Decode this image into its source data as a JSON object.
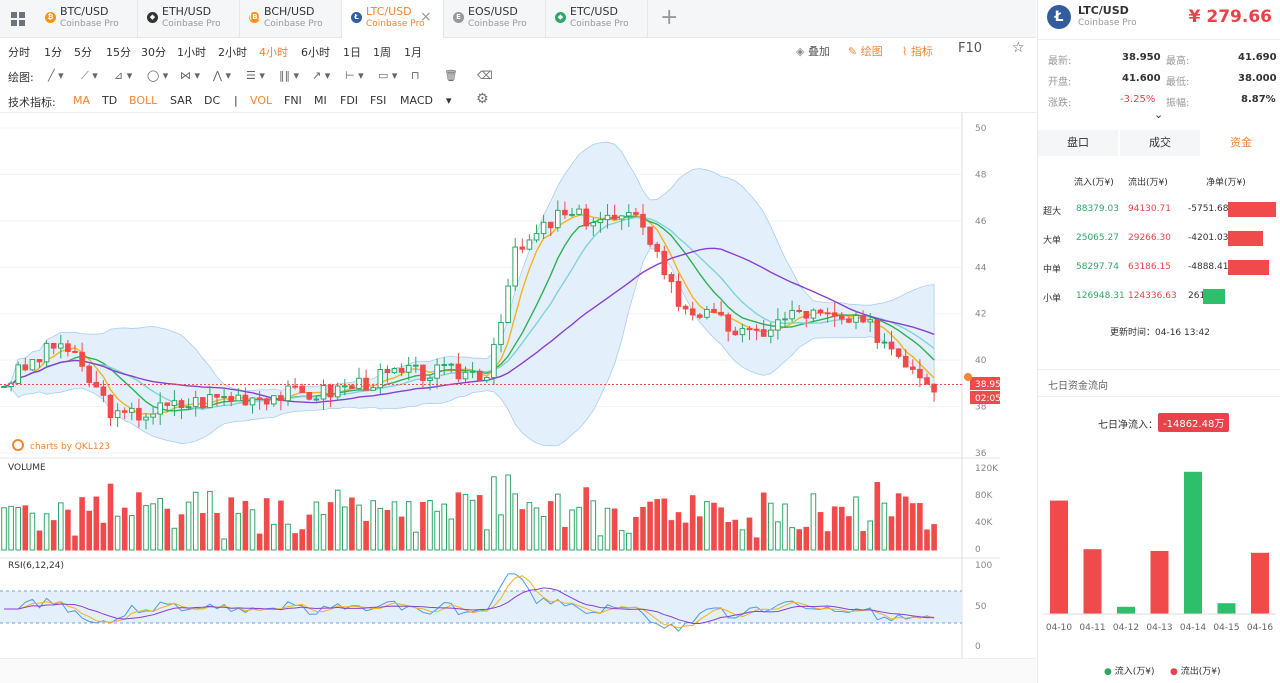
{
  "tabs": [
    {
      "symbol": "BTC/USD",
      "exchange": "Coinbase Pro",
      "icon": "bitcoin-icon",
      "color": "#f7931a",
      "glyph": "₿"
    },
    {
      "symbol": "ETH/USD",
      "exchange": "Coinbase Pro",
      "icon": "ethereum-icon",
      "color": "#333333",
      "glyph": "◆"
    },
    {
      "symbol": "BCH/USD",
      "exchange": "Coinbase Pro",
      "icon": "bitcoin-cash-icon",
      "color": "#f7931a",
      "glyph": "(B)"
    },
    {
      "symbol": "LTC/USD",
      "exchange": "Coinbase Pro",
      "icon": "litecoin-icon",
      "color": "#345d9d",
      "glyph": "Ł",
      "active": true
    },
    {
      "symbol": "EOS/USD",
      "exchange": "Coinbase Pro",
      "icon": "eos-icon",
      "color": "#999999",
      "glyph": "E"
    },
    {
      "symbol": "ETC/USD",
      "exchange": "Coinbase Pro",
      "icon": "etc-icon",
      "color": "#2da866",
      "glyph": "◆"
    }
  ],
  "timeframes": [
    "分时",
    "1分",
    "5分",
    "15分",
    "30分",
    "1小时",
    "2小时",
    "4小时",
    "6小时",
    "1日",
    "1周",
    "1月"
  ],
  "active_timeframe": "4小时",
  "toolbar_right": {
    "overlay": "叠加",
    "draw": "绘图",
    "indicator": "指标",
    "f10": "F10"
  },
  "draw_label": "绘图:",
  "indicator_label": "技术指标:",
  "main_indicators": [
    "MA",
    "TD",
    "BOLL",
    "SAR",
    "DC"
  ],
  "sub_indicators": [
    "VOL",
    "FNI",
    "MI",
    "FDI",
    "FSI",
    "MACD"
  ],
  "chart": {
    "y_ticks": [
      "50",
      "48",
      "46",
      "44",
      "42",
      "40",
      "38",
      "36"
    ],
    "vol_ticks": [
      "120K",
      "80K",
      "40K",
      "0"
    ],
    "rsi_ticks": [
      "100",
      "50",
      "0"
    ],
    "x_ticks": [
      "3/29",
      "4/2",
      "4/5",
      "4/9",
      "4/12",
      "4/16"
    ],
    "price_tag": "38.950",
    "countdown_tag": "02:05:59",
    "watermark": "charts by QKL123",
    "volume_label": "VOLUME",
    "rsi_label": "RSI(6,12,24)"
  },
  "header": {
    "symbol": "LTC/USD",
    "exchange": "Coinbase Pro",
    "price": "¥ 279.66"
  },
  "stats": {
    "latest_l": "最新:",
    "latest": "38.950",
    "high_l": "最高:",
    "high": "41.690",
    "open_l": "开盘:",
    "open": "41.600",
    "low_l": "最低:",
    "low": "38.000",
    "chg_l": "涨跌:",
    "chg": "-3.25%",
    "amp_l": "振幅:",
    "amp": "8.87%"
  },
  "sub_tabs": [
    "盘口",
    "成交",
    "资金"
  ],
  "flow": {
    "headers": [
      "流入(万¥)",
      "流出(万¥)",
      "净单(万¥)"
    ],
    "rows": [
      {
        "name": "超大",
        "in": "88379.03",
        "out": "94130.71",
        "net": "-5751.68",
        "v": -5751.68
      },
      {
        "name": "大单",
        "in": "25065.27",
        "out": "29266.30",
        "net": "-4201.03",
        "v": -4201.03
      },
      {
        "name": "中单",
        "in": "58297.74",
        "out": "63186.15",
        "net": "-4888.41",
        "v": -4888.41
      },
      {
        "name": "小单",
        "in": "126948.31",
        "out": "124336.63",
        "net": "2611.68",
        "v": 2611.68
      }
    ],
    "updated": "更新时间：04-16 13:42"
  },
  "seven_day": {
    "title": "七日资金流向",
    "net_label": "七日净流入：",
    "net_value": "-14862.48万",
    "bars": [
      {
        "date": "04-10",
        "flow": "out",
        "h": 0.63
      },
      {
        "date": "04-11",
        "flow": "out",
        "h": 0.36
      },
      {
        "date": "04-12",
        "flow": "in",
        "h": 0.04
      },
      {
        "date": "04-13",
        "flow": "out",
        "h": 0.35
      },
      {
        "date": "04-14",
        "flow": "in",
        "h": 0.79
      },
      {
        "date": "04-15",
        "flow": "in",
        "h": 0.06
      },
      {
        "date": "04-16",
        "flow": "out",
        "h": 0.34
      }
    ],
    "legend_in": "流入(万¥)",
    "legend_out": "流出(万¥)"
  },
  "colors": {
    "up": "#2da866",
    "down": "#f04a4a",
    "accent": "#f38533",
    "ma1": "#f5b31b",
    "ma2": "#2db052",
    "ma3": "#8a3fd0",
    "boll": "#cfe5f8"
  }
}
